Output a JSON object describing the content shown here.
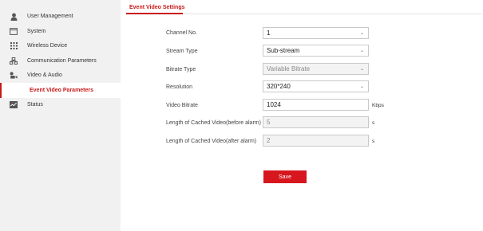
{
  "sidebar": {
    "items": [
      {
        "label": "User Management",
        "icon": "user-icon"
      },
      {
        "label": "System",
        "icon": "system-icon"
      },
      {
        "label": "Wireless Device",
        "icon": "wireless-device-icon"
      },
      {
        "label": "Communication Parameters",
        "icon": "communication-icon"
      },
      {
        "label": "Video & Audio",
        "icon": "video-audio-icon"
      },
      {
        "label": "Event Video Parameters"
      },
      {
        "label": "Status",
        "icon": "status-icon"
      }
    ],
    "active_index": 5
  },
  "tab": {
    "label": "Event Video Settings"
  },
  "form": {
    "channel": {
      "label": "Channel No.",
      "value": "1"
    },
    "stream_type": {
      "label": "Stream Type",
      "value": "Sub-stream"
    },
    "bitrate_type": {
      "label": "Bitrate Type",
      "value": "Variable Bitrate"
    },
    "resolution": {
      "label": "Resolution",
      "value": "320*240"
    },
    "video_bitrate": {
      "label": "Video Bitrate",
      "value": "1024",
      "unit": "Kbps"
    },
    "cached_before": {
      "label": "Length of Cached Video(before alarm)",
      "value": "5",
      "unit": "s"
    },
    "cached_after": {
      "label": "Length of Cached Video(after alarm)",
      "value": "2",
      "unit": "s"
    }
  },
  "save_label": "Save",
  "colors": {
    "accent": "#c81919",
    "button": "#d7161e",
    "sidebar_bg": "#f1f1f1"
  }
}
